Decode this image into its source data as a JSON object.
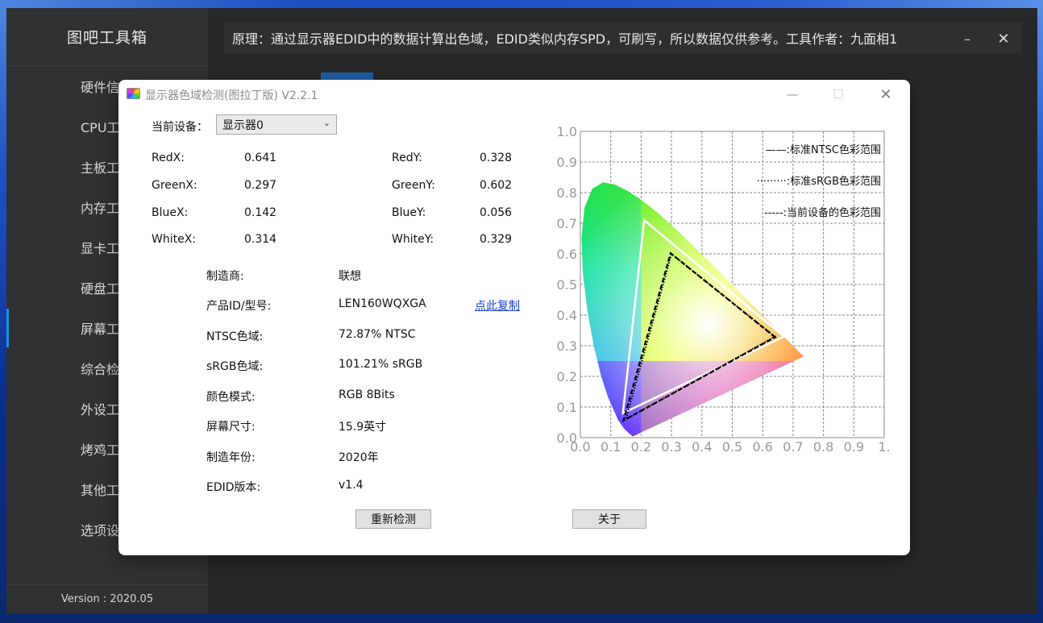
{
  "host": {
    "app_title": "图吧工具箱",
    "topbar_text": "原理：通过显示器EDID中的数据计算出色域，EDID类似内存SPD，可刷写，所以数据仅供参考。工具作者：九面相1",
    "min_symbol": "–",
    "close_symbol": "✕",
    "version": "Version : 2020.05",
    "nav_items": [
      "硬件信",
      "CPU工",
      "主板工",
      "内存工",
      "显卡工",
      "硬盘工",
      "屏幕工",
      "综合检",
      "外设工",
      "烤鸡工",
      "其他工",
      "选项设"
    ]
  },
  "dialog": {
    "title": "显示器色域检测(图拉丁版) V2.2.1",
    "min_symbol": "—",
    "max_symbol": "☐",
    "close_symbol": "✕",
    "device_label": "当前设备：",
    "device_value": "显示器0",
    "device_arrow": "⌄",
    "coords": [
      {
        "label": "RedX:",
        "value": "0.641",
        "label2": "RedY:",
        "value2": "0.328"
      },
      {
        "label": "GreenX:",
        "value": "0.297",
        "label2": "GreenY:",
        "value2": "0.602"
      },
      {
        "label": "BlueX:",
        "value": "0.142",
        "label2": "BlueY:",
        "value2": "0.056"
      },
      {
        "label": "WhiteX:",
        "value": "0.314",
        "label2": "WhiteY:",
        "value2": "0.329"
      }
    ],
    "info": [
      {
        "label": "制造商:",
        "value": "联想"
      },
      {
        "label": "产品ID/型号:",
        "value": "LEN160WQXGA"
      },
      {
        "label": "NTSC色域:",
        "value": "72.87% NTSC"
      },
      {
        "label": "sRGB色域:",
        "value": "101.21% sRGB"
      },
      {
        "label": "颜色模式:",
        "value": "RGB 8Bits"
      },
      {
        "label": "屏幕尺寸:",
        "value": "15.9英寸"
      },
      {
        "label": "制造年份:",
        "value": "2020年"
      },
      {
        "label": "EDID版本:",
        "value": "v1.4"
      }
    ],
    "copy_link": "点此复制",
    "recheck_button": "重新检测",
    "about_button": "关于"
  },
  "chart_data": {
    "type": "scatter",
    "title": "",
    "xlim": [
      0,
      1.0
    ],
    "ylim": [
      0,
      1.0
    ],
    "x_ticks": [
      "0.0",
      "0.1",
      "0.2",
      "0.3",
      "0.4",
      "0.5",
      "0.6",
      "0.7",
      "0.8",
      "0.9",
      "1."
    ],
    "y_ticks": [
      "0.0",
      "0.1",
      "0.2",
      "0.3",
      "0.4",
      "0.5",
      "0.6",
      "0.7",
      "0.8",
      "0.9",
      "1.0"
    ],
    "grid": true,
    "legend_position": "top-right",
    "legend": [
      {
        "label": "——:标准NTSC色彩范围"
      },
      {
        "label": "·········:标准sRGB色彩范围"
      },
      {
        "label": "-----:当前设备的色彩范围"
      }
    ],
    "series": [
      {
        "points": [
          [
            0.67,
            0.33
          ],
          [
            0.21,
            0.71
          ],
          [
            0.14,
            0.08
          ]
        ],
        "color": "#ffffff"
      },
      {
        "points": [
          [
            0.64,
            0.33
          ],
          [
            0.3,
            0.6
          ],
          [
            0.15,
            0.06
          ]
        ],
        "color": "#000000"
      },
      {
        "points": [
          [
            0.641,
            0.328
          ],
          [
            0.297,
            0.602
          ],
          [
            0.142,
            0.056
          ]
        ],
        "color": "#000000"
      }
    ],
    "spectral_locus": [
      [
        0.1741,
        0.005
      ],
      [
        0.1738,
        0.0049
      ],
      [
        0.1733,
        0.0048
      ],
      [
        0.1726,
        0.0048
      ],
      [
        0.1714,
        0.0051
      ],
      [
        0.1689,
        0.0069
      ],
      [
        0.1644,
        0.0109
      ],
      [
        0.1566,
        0.0177
      ],
      [
        0.144,
        0.0297
      ],
      [
        0.1241,
        0.0578
      ],
      [
        0.0913,
        0.1327
      ],
      [
        0.0687,
        0.2007
      ],
      [
        0.0454,
        0.295
      ],
      [
        0.0235,
        0.4127
      ],
      [
        0.0082,
        0.5384
      ],
      [
        0.0039,
        0.6548
      ],
      [
        0.0139,
        0.7502
      ],
      [
        0.0389,
        0.812
      ],
      [
        0.0743,
        0.8338
      ],
      [
        0.1142,
        0.8262
      ],
      [
        0.1547,
        0.8059
      ],
      [
        0.1929,
        0.7816
      ],
      [
        0.2296,
        0.7543
      ],
      [
        0.2658,
        0.7243
      ],
      [
        0.3016,
        0.6923
      ],
      [
        0.3373,
        0.6589
      ],
      [
        0.3731,
        0.6245
      ],
      [
        0.4087,
        0.5896
      ],
      [
        0.4441,
        0.5547
      ],
      [
        0.4788,
        0.5202
      ],
      [
        0.5125,
        0.4866
      ],
      [
        0.5448,
        0.4544
      ],
      [
        0.5752,
        0.4242
      ],
      [
        0.6029,
        0.3965
      ],
      [
        0.627,
        0.3725
      ],
      [
        0.6482,
        0.3514
      ],
      [
        0.6658,
        0.334
      ],
      [
        0.6801,
        0.3197
      ],
      [
        0.6915,
        0.3083
      ],
      [
        0.7006,
        0.2993
      ],
      [
        0.7079,
        0.292
      ],
      [
        0.714,
        0.2859
      ],
      [
        0.7347,
        0.2653
      ]
    ]
  }
}
